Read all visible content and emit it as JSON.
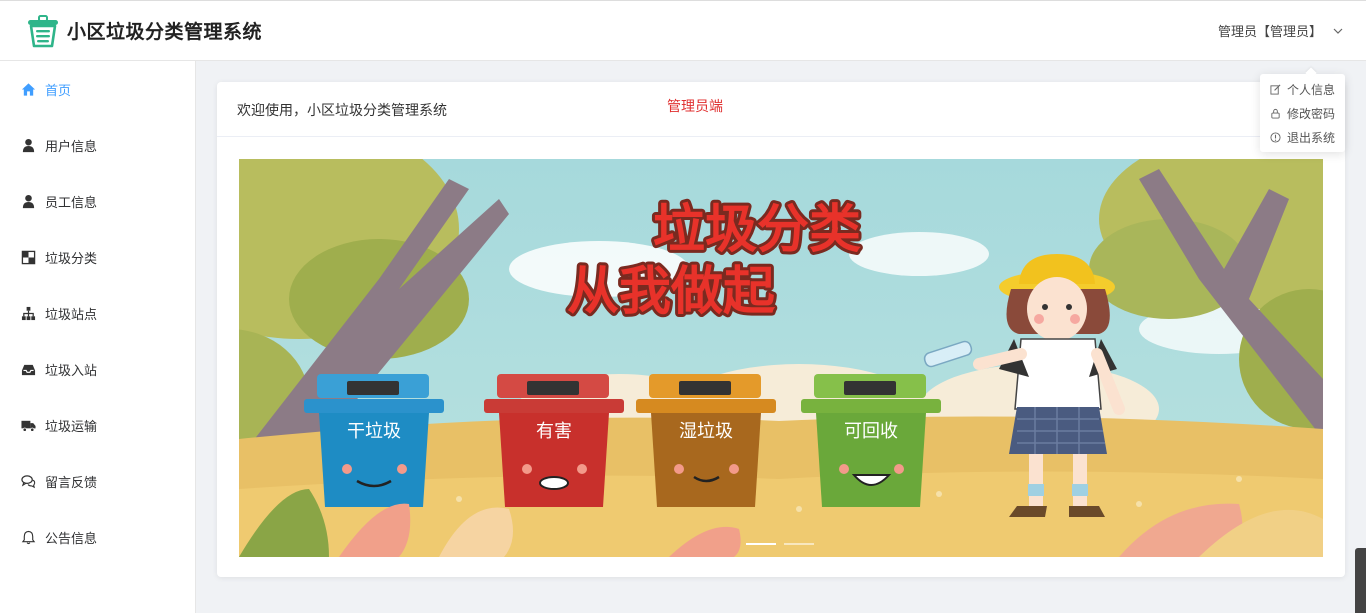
{
  "header": {
    "app_title": "小区垃圾分类管理系统",
    "user_label": "管理员【管理员】"
  },
  "dropdown": {
    "items": [
      {
        "label": "个人信息",
        "icon": "edit-icon"
      },
      {
        "label": "修改密码",
        "icon": "lock-icon"
      },
      {
        "label": "退出系统",
        "icon": "info-circle-icon"
      }
    ]
  },
  "sidebar": {
    "items": [
      {
        "label": "首页",
        "icon": "home-icon",
        "active": true
      },
      {
        "label": "用户信息",
        "icon": "user-icon"
      },
      {
        "label": "员工信息",
        "icon": "user-icon"
      },
      {
        "label": "垃圾分类",
        "icon": "chess-board-icon"
      },
      {
        "label": "垃圾站点",
        "icon": "sitemap-icon"
      },
      {
        "label": "垃圾入站",
        "icon": "inbox-icon"
      },
      {
        "label": "垃圾运输",
        "icon": "truck-icon"
      },
      {
        "label": "留言反馈",
        "icon": "comments-icon"
      },
      {
        "label": "公告信息",
        "icon": "bell-icon"
      }
    ]
  },
  "main": {
    "welcome": "欢迎使用，小区垃圾分类管理系统",
    "role_tag": "管理员端",
    "banner": {
      "line1": "垃圾分类",
      "line2": "从我做起",
      "bins": [
        "干垃圾",
        "有害",
        "湿垃圾",
        "可回收"
      ]
    },
    "carousel_slides": 2,
    "active_slide": 1
  },
  "colors": {
    "accent": "#409eff",
    "role_red": "#e03030",
    "bin_blue": "#1e8cc4",
    "bin_red": "#c8302c",
    "bin_brown": "#a8681e",
    "bin_green": "#6aa83a"
  }
}
